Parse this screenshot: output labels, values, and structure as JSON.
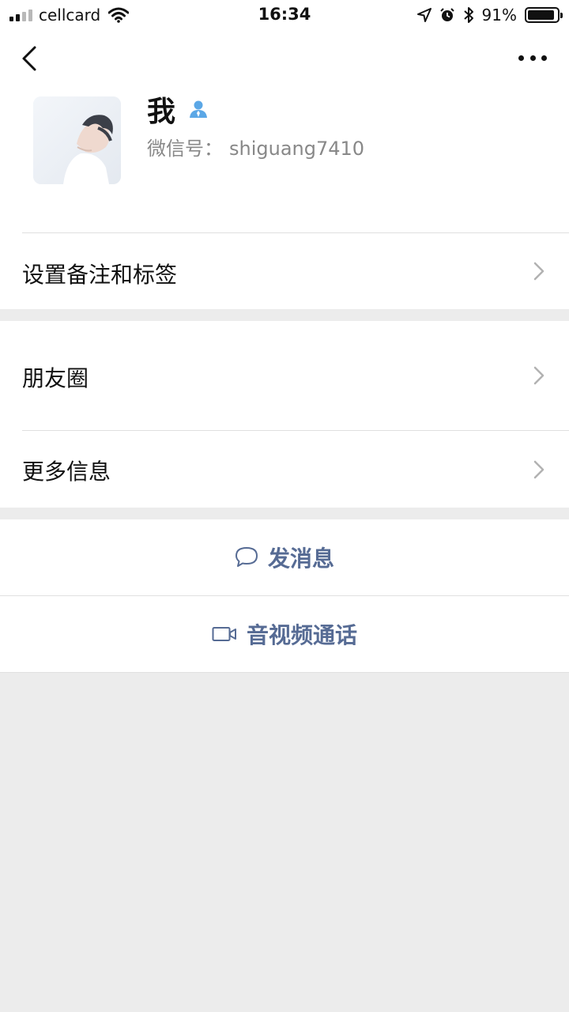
{
  "status_bar": {
    "carrier": "cellcard",
    "time": "16:34",
    "battery_percent_text": "91%",
    "battery_level": 0.91,
    "icons": [
      "signal-icon",
      "wifi-icon",
      "location-arrow-icon",
      "alarm-icon",
      "bluetooth-icon",
      "battery-icon"
    ]
  },
  "nav": {
    "back_icon": "chevron-left-icon",
    "more_icon": "more-dots-icon"
  },
  "profile": {
    "name": "我",
    "badge_icon": "person-badge-icon",
    "wechat_id_label": "微信号：",
    "wechat_id_value": "shiguang7410",
    "avatar": "avatar-image"
  },
  "rows": {
    "remark_tags": "设置备注和标签",
    "moments": "朋友圈",
    "more_info": "更多信息"
  },
  "actions": {
    "send_message": "发消息",
    "send_message_icon": "chat-bubble-icon",
    "av_call": "音视频通话",
    "av_call_icon": "video-camera-icon"
  },
  "colors": {
    "accent_link": "#566b94",
    "badge": "#5ba7e6",
    "background": "#ececec"
  }
}
